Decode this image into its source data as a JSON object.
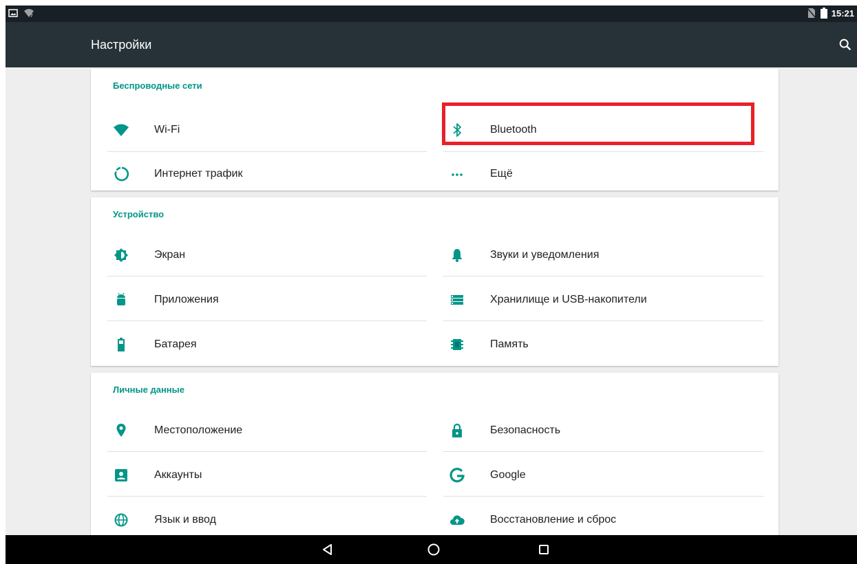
{
  "status_bar": {
    "time": "15:21",
    "left_icons": [
      "image-notification-icon",
      "wifi-unknown-icon"
    ],
    "right_icons": [
      "no-sim-icon",
      "battery-icon"
    ]
  },
  "toolbar": {
    "title": "Настройки",
    "search_icon": "search-icon"
  },
  "sections": {
    "wireless": {
      "header": "Беспроводные сети",
      "items": [
        {
          "label": "Wi-Fi",
          "icon": "wifi-icon"
        },
        {
          "label": "Bluetooth",
          "icon": "bluetooth-icon"
        },
        {
          "label": "Интернет трафик",
          "icon": "data-usage-icon"
        },
        {
          "label": "Ещё",
          "icon": "more-icon"
        }
      ]
    },
    "device": {
      "header": "Устройство",
      "items": [
        {
          "label": "Экран",
          "icon": "display-icon"
        },
        {
          "label": "Звуки и уведомления",
          "icon": "bell-icon"
        },
        {
          "label": "Приложения",
          "icon": "android-icon"
        },
        {
          "label": "Хранилище и USB-накопители",
          "icon": "storage-icon"
        },
        {
          "label": "Батарея",
          "icon": "battery-icon"
        },
        {
          "label": "Память",
          "icon": "memory-icon"
        }
      ]
    },
    "personal": {
      "header": "Личные данные",
      "items": [
        {
          "label": "Местоположение",
          "icon": "location-icon"
        },
        {
          "label": "Безопасность",
          "icon": "lock-icon"
        },
        {
          "label": "Аккаунты",
          "icon": "account-icon"
        },
        {
          "label": "Google",
          "icon": "google-icon"
        },
        {
          "label": "Язык и ввод",
          "icon": "globe-icon"
        },
        {
          "label": "Восстановление и сброс",
          "icon": "cloud-upload-icon"
        }
      ]
    }
  },
  "nav_bar": {
    "buttons": [
      "back-icon",
      "home-icon",
      "recents-icon"
    ]
  },
  "colors": {
    "accent": "#009688",
    "toolbar": "#263238",
    "status_bar": "#192025",
    "highlight": "#e8202a",
    "background": "#eeeeee"
  }
}
